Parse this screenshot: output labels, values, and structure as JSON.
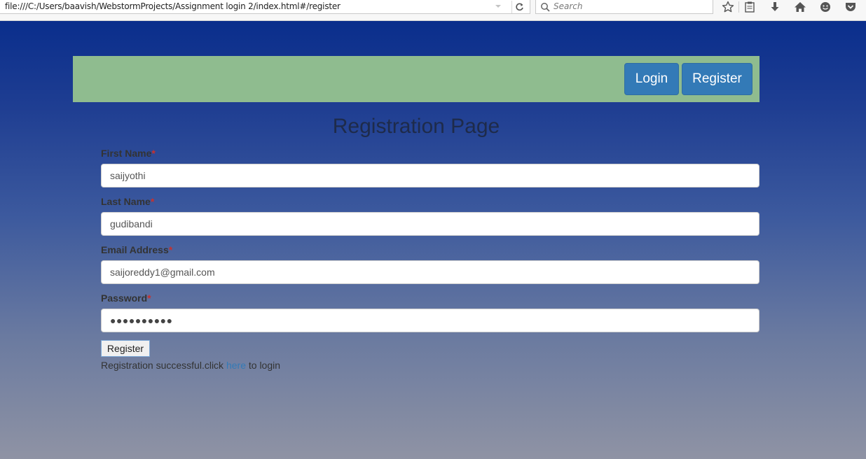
{
  "browser": {
    "url": "file:///C:/Users/baavish/WebstormProjects/Assignment login 2/index.html#/register",
    "search_placeholder": "Search",
    "icons": [
      "url-dropdown-icon",
      "reload-icon",
      "search-icon",
      "bookmark-star-icon",
      "reading-list-icon",
      "download-icon",
      "home-icon",
      "smiley-icon",
      "pocket-icon"
    ]
  },
  "nav": {
    "login_label": "Login",
    "register_label": "Register",
    "bar_color": "#8fbc8f",
    "button_color": "#337ab7"
  },
  "page": {
    "title": "Registration Page"
  },
  "form": {
    "required_mark": "*",
    "first_name": {
      "label": "First Name",
      "value": "saijyothi"
    },
    "last_name": {
      "label": "Last Name",
      "value": "gudibandi"
    },
    "email": {
      "label": "Email Address",
      "value": "saijoreddy1@gmail.com"
    },
    "password": {
      "label": "Password",
      "masked": "●●●●●●●●●●"
    },
    "submit_label": "Register"
  },
  "status": {
    "before": "Registration successful.click",
    "link": "here",
    "after": "to login"
  }
}
